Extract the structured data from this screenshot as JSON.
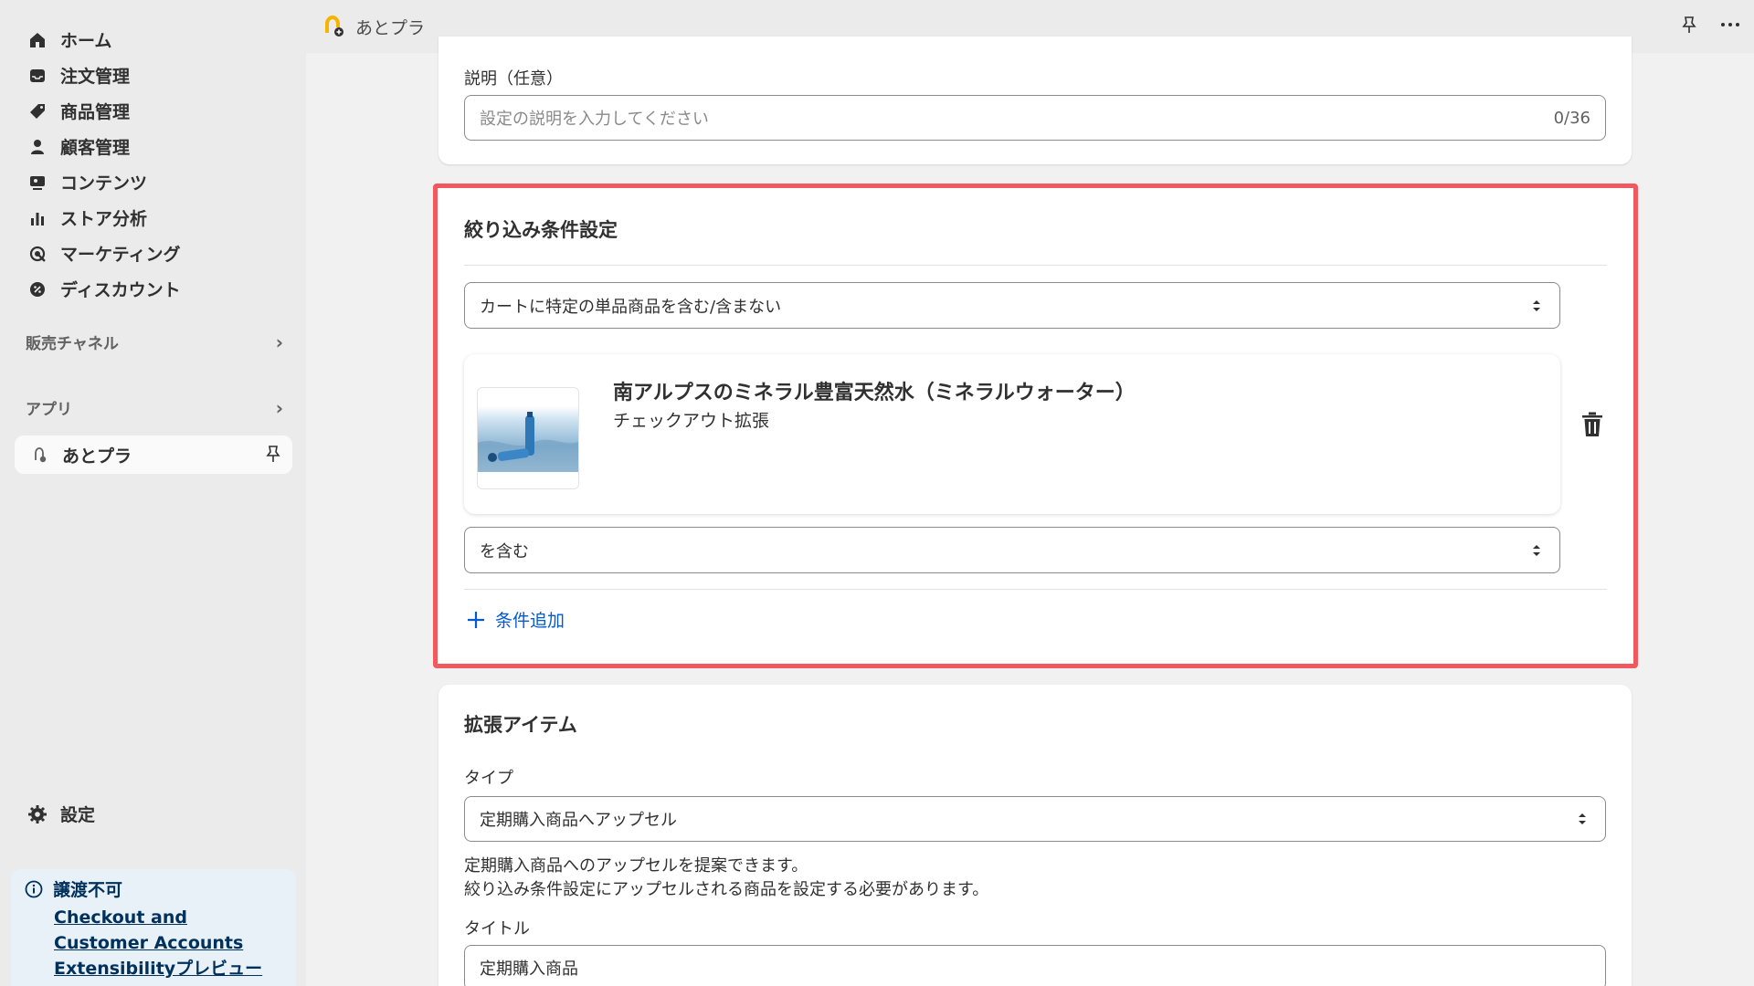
{
  "sidebar": {
    "items": [
      {
        "label": "ホーム",
        "icon": "home-icon"
      },
      {
        "label": "注文管理",
        "icon": "inbox-icon"
      },
      {
        "label": "商品管理",
        "icon": "tag-icon"
      },
      {
        "label": "顧客管理",
        "icon": "person-icon"
      },
      {
        "label": "コンテンツ",
        "icon": "content-icon"
      },
      {
        "label": "ストア分析",
        "icon": "bar-chart-icon"
      },
      {
        "label": "マーケティング",
        "icon": "target-icon"
      },
      {
        "label": "ディスカウント",
        "icon": "discount-icon"
      }
    ],
    "sales_channels": "販売チャネル",
    "apps": "アプリ",
    "active_app": "あとプラ",
    "settings": "設定",
    "notice": {
      "title": "譲渡不可",
      "link": "Checkout and Customer Accounts Extensibilityプレビュー"
    }
  },
  "topbar": {
    "title": "あとプラ"
  },
  "description": {
    "label": "説明（任意）",
    "placeholder": "設定の説明を入力してください",
    "counter": "0/36"
  },
  "filter": {
    "title": "絞り込み条件設定",
    "condition_select": "カートに特定の単品商品を含む/含まない",
    "product": {
      "name": "南アルプスのミネラル豊富天然水（ミネラルウォーター）",
      "subtitle": "チェックアウト拡張"
    },
    "include_select": "を含む",
    "add_condition": "条件追加"
  },
  "extension": {
    "title": "拡張アイテム",
    "type_label": "タイプ",
    "type_select": "定期購入商品へアップセル",
    "help_line1": "定期購入商品へのアップセルを提案できます。",
    "help_line2": "絞り込み条件設定にアップセルされる商品を設定する必要があります。",
    "title_label": "タイトル",
    "title_value": "定期購入商品"
  },
  "colors": {
    "highlight": "#f05a5e",
    "link": "#005bd3"
  }
}
